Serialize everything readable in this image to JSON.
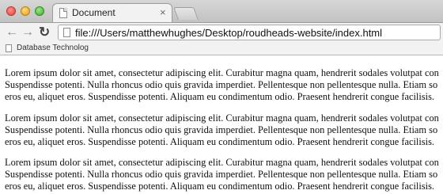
{
  "window": {
    "tab": {
      "title": "Document",
      "close_glyph": "×"
    }
  },
  "toolbar": {
    "back_glyph": "←",
    "forward_glyph": "→",
    "reload_glyph": "↻",
    "address": "file:///Users/matthewhughes/Desktop/roudheads-website/index.html"
  },
  "bookmarks": {
    "items": [
      {
        "label": "Database Technolog"
      }
    ]
  },
  "page": {
    "paragraphs": [
      {
        "lines": [
          "Lorem ipsum dolor sit amet, consectetur adipiscing elit. Curabitur magna quam, hendrerit sodales volutpat con",
          "Suspendisse potenti. Nulla rhoncus odio quis gravida imperdiet. Pellentesque non pellentesque nulla. Etiam so",
          "eros eu, aliquet eros. Suspendisse potenti. Aliquam eu condimentum odio. Praesent hendrerit congue facilisis."
        ]
      },
      {
        "lines": [
          "Lorem ipsum dolor sit amet, consectetur adipiscing elit. Curabitur magna quam, hendrerit sodales volutpat con",
          "Suspendisse potenti. Nulla rhoncus odio quis gravida imperdiet. Pellentesque non pellentesque nulla. Etiam so",
          "eros eu, aliquet eros. Suspendisse potenti. Aliquam eu condimentum odio. Praesent hendrerit congue facilisis."
        ]
      },
      {
        "lines": [
          "Lorem ipsum dolor sit amet, consectetur adipiscing elit. Curabitur magna quam, hendrerit sodales volutpat con",
          "Suspendisse potenti. Nulla rhoncus odio quis gravida imperdiet. Pellentesque non pellentesque nulla. Etiam so",
          "eros eu, aliquet eros. Suspendisse potenti. Aliquam eu condimentum odio. Praesent hendrerit congue facilisis."
        ]
      }
    ]
  }
}
